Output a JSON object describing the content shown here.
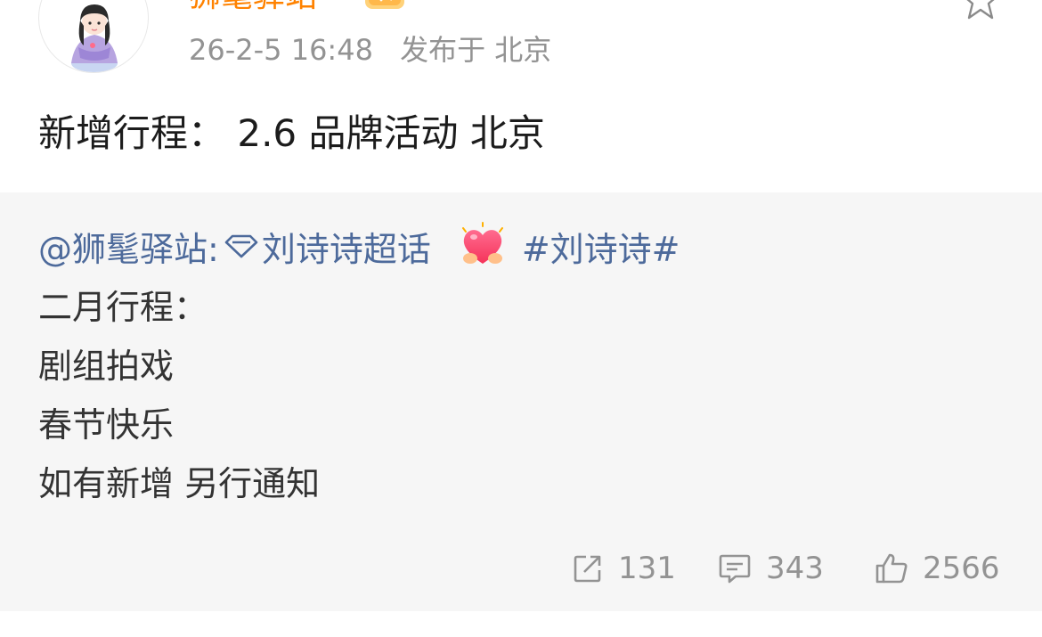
{
  "header": {
    "username": "狮髦驿站",
    "timestamp": "26-2-5 16:48",
    "location": "发布于 北京",
    "avatar_icon": "avatar-illustration",
    "badge_icon": "vip-badge-icon",
    "favorite_icon": "star-outline-icon",
    "username_color": "#ff8200"
  },
  "post": {
    "text": "新增行程：  2.6 品牌活动 北京"
  },
  "repost": {
    "author_mention": "@狮髦驿站:",
    "supertopic": "刘诗诗超话",
    "hashtag": "#刘诗诗#",
    "link_color": "#4d6a9b",
    "lines": [
      "二月行程：",
      "剧组拍戏",
      "春节快乐",
      "如有新增 另行通知"
    ]
  },
  "actions": {
    "repost_count": "131",
    "comment_count": "343",
    "like_count": "2566"
  }
}
